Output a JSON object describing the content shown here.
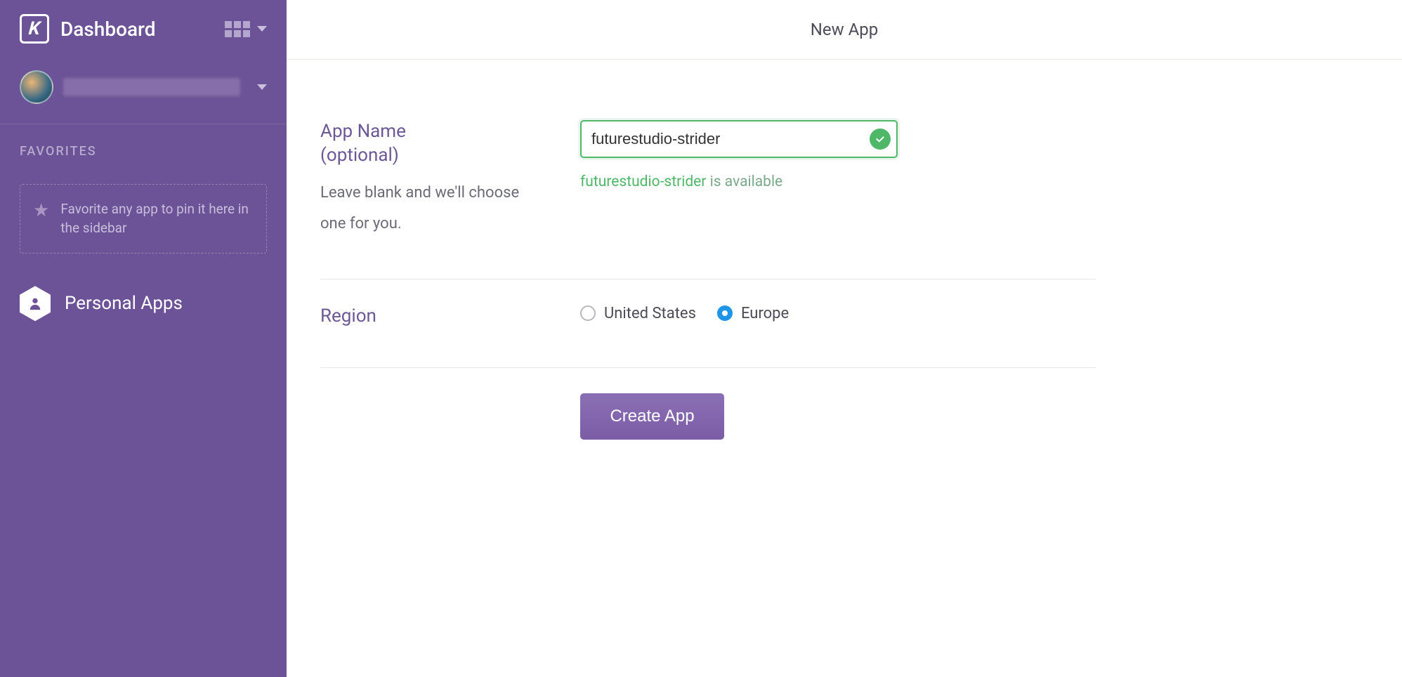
{
  "sidebar": {
    "title": "Dashboard",
    "favorites_label": "FAVORITES",
    "favorites_hint": "Favorite any app to pin it here in the sidebar",
    "personal_apps_label": "Personal Apps"
  },
  "header": {
    "page_title": "New App"
  },
  "form": {
    "app_name": {
      "label_line1": "App Name",
      "label_line2": "(optional)",
      "help": "Leave blank and we'll choose one for you.",
      "value": "futurestudio-strider",
      "availability_name": "futurestudio-strider",
      "availability_suffix": " is available"
    },
    "region": {
      "label": "Region",
      "options": [
        {
          "label": "United States",
          "selected": false
        },
        {
          "label": "Europe",
          "selected": true
        }
      ]
    },
    "submit_label": "Create App"
  },
  "colors": {
    "sidebar_bg": "#6c5296",
    "accent_purple": "#6b5896",
    "success_green": "#4fb768",
    "radio_blue": "#1f95e8"
  }
}
